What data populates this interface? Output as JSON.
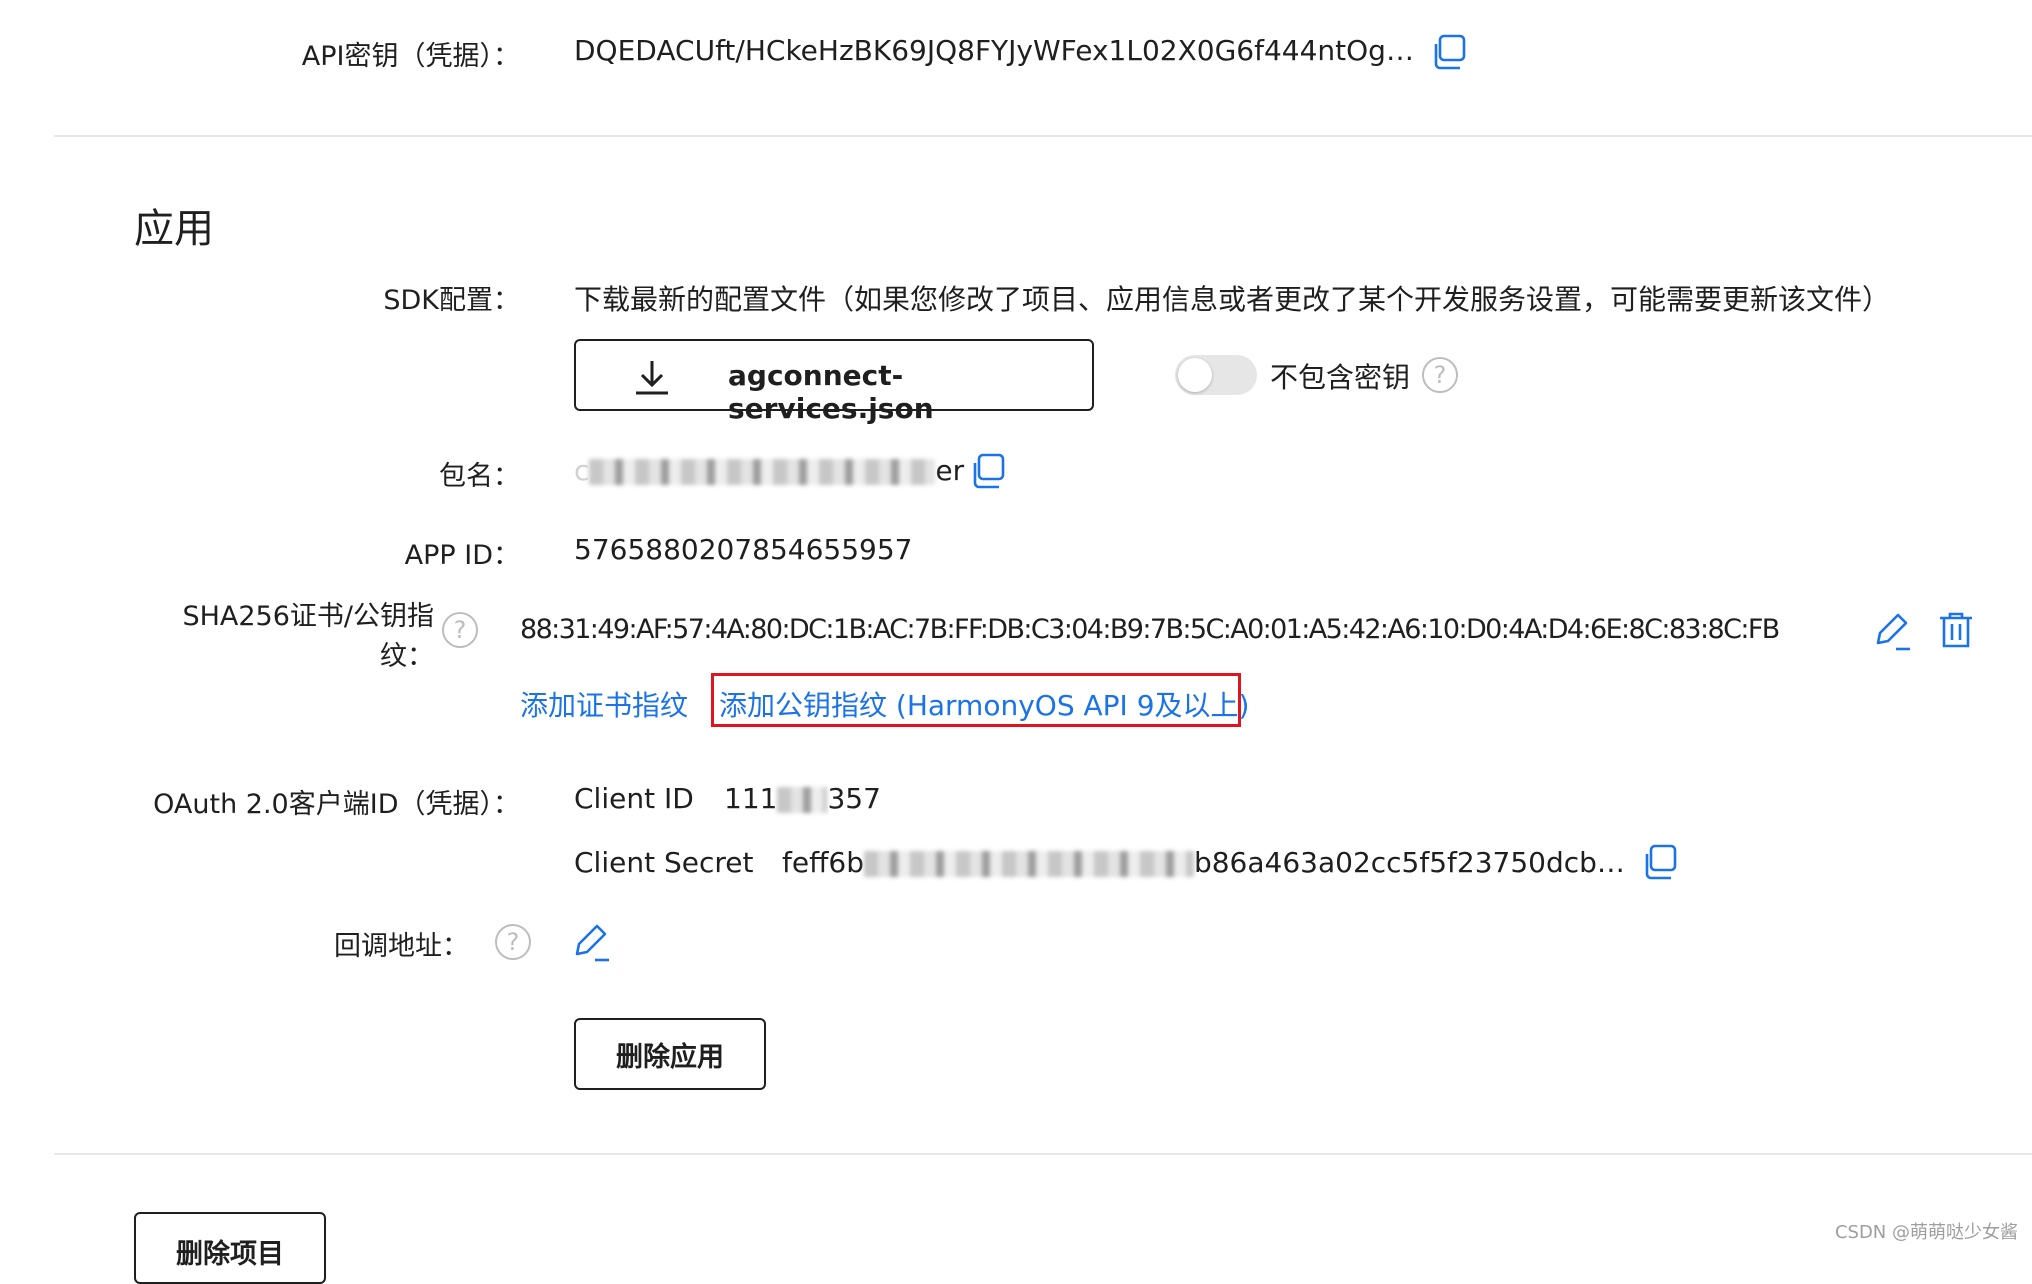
{
  "api_key": {
    "label": "API密钥（凭据）：",
    "value": "DQEDACUft/HCkeHzBK69JQ8FYJyWFex1L02X0G6f444ntOg…",
    "copy_icon": "copy-icon"
  },
  "section": {
    "title": "应用"
  },
  "sdk": {
    "label": "SDK配置：",
    "description": "下载最新的配置文件（如果您修改了项目、应用信息或者更改了某个开发服务设置，可能需要更新该文件）",
    "download_button": "agconnect-services.json",
    "download_icon": "download-icon",
    "toggle_label": "不包含密钥",
    "toggle_on": false,
    "help_icon": "help-icon"
  },
  "package": {
    "label": "包名：",
    "value_prefix": "c",
    "value_suffix": "er",
    "copy_icon": "copy-icon"
  },
  "app_id": {
    "label": "APP ID：",
    "value": "5765880207854655957"
  },
  "sha256": {
    "label_line1": "SHA256证书/公钥指",
    "label_line2": "纹：",
    "value": "88:31:49:AF:57:4A:80:DC:1B:AC:7B:FF:DB:C3:04:B9:7B:5C:A0:01:A5:42:A6:10:D0:4A:D4:6E:8C:83:8C:FB",
    "add_cert_link": "添加证书指纹",
    "add_pubkey_link": "添加公钥指纹 (HarmonyOS API 9及以上)",
    "highlight_color": "#e0141e"
  },
  "oauth": {
    "label": "OAuth 2.0客户端ID（凭据）：",
    "client_id_label": "Client ID",
    "client_id_prefix": "111",
    "client_id_suffix": "357",
    "client_secret_label": "Client Secret",
    "client_secret_prefix": "feff6b",
    "client_secret_suffix": "b86a463a02cc5f5f23750dcb…"
  },
  "callback": {
    "label": "回调地址："
  },
  "delete_app_button": "删除应用",
  "delete_project_button": "删除项目",
  "watermark": "CSDN @萌萌哒少女酱",
  "colors": {
    "accent": "#1a73e8",
    "text": "#1f1f1f",
    "divider": "#e8e8e8"
  }
}
